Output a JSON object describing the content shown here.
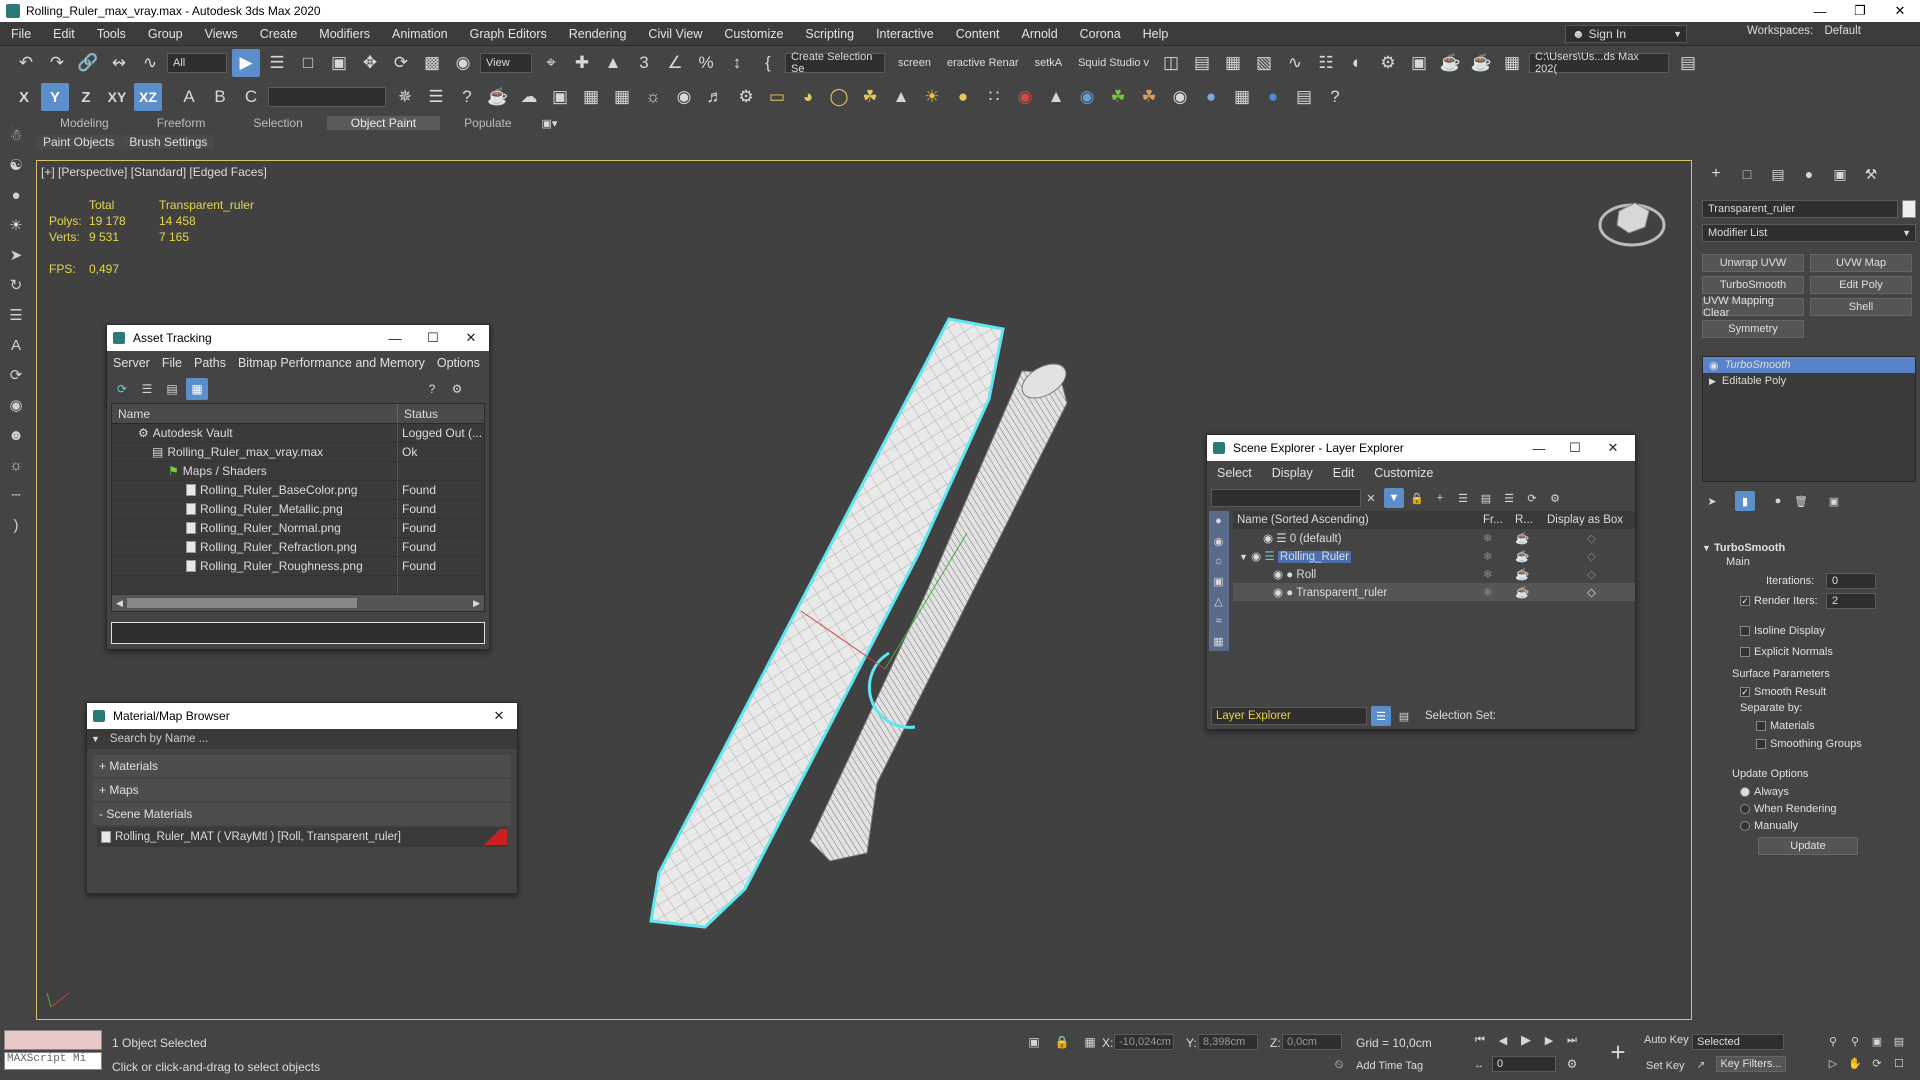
{
  "window": {
    "title": "Rolling_Ruler_max_vray.max - Autodesk 3ds Max 2020"
  },
  "menu": [
    "File",
    "Edit",
    "Tools",
    "Group",
    "Views",
    "Create",
    "Modifiers",
    "Animation",
    "Graph Editors",
    "Rendering",
    "Civil View",
    "Customize",
    "Scripting",
    "Interactive",
    "Content",
    "Arnold",
    "Corona",
    "Help"
  ],
  "signin": {
    "label": "Sign In"
  },
  "workspaces": {
    "label": "Workspaces:",
    "value": "Default"
  },
  "toolbar1": {
    "filter": "All",
    "view": "View",
    "selection_set": "Create Selection Se",
    "screen": "screen",
    "interactive": "eractive Renar",
    "setka": "setkA",
    "squid": "Squid Studio v",
    "path": "C:\\Users\\Us...ds Max 202("
  },
  "toolbar2": {
    "axis_x": "X",
    "axis_y": "Y",
    "axis_z": "Z",
    "axis_xy": "XY",
    "axis_xz": "XZ"
  },
  "ribbon": {
    "tabs": [
      "Modeling",
      "Freeform",
      "Selection",
      "Object Paint",
      "Populate"
    ],
    "active": "Object Paint",
    "sub": [
      "Paint Objects",
      "Brush Settings"
    ]
  },
  "viewport": {
    "label": "[+] [Perspective] [Standard] [Edged Faces]",
    "stats": {
      "header_total": "Total",
      "header_obj": "Transparent_ruler",
      "polys_label": "Polys:",
      "polys_total": "19 178",
      "polys_obj": "14 458",
      "verts_label": "Verts:",
      "verts_total": "9 531",
      "verts_obj": "7 165",
      "fps_label": "FPS:",
      "fps_value": "0,497"
    }
  },
  "asset_tracking": {
    "title": "Asset Tracking",
    "menu": [
      "Server",
      "File",
      "Paths",
      "Bitmap Performance and Memory",
      "Options"
    ],
    "columns": [
      "Name",
      "Status"
    ],
    "rows": [
      {
        "name": "Autodesk Vault",
        "status": "Logged Out (..."
      },
      {
        "name": "Rolling_Ruler_max_vray.max",
        "status": "Ok"
      },
      {
        "name": "Maps / Shaders",
        "status": ""
      },
      {
        "name": "Rolling_Ruler_BaseColor.png",
        "status": "Found"
      },
      {
        "name": "Rolling_Ruler_Metallic.png",
        "status": "Found"
      },
      {
        "name": "Rolling_Ruler_Normal.png",
        "status": "Found"
      },
      {
        "name": "Rolling_Ruler_Refraction.png",
        "status": "Found"
      },
      {
        "name": "Rolling_Ruler_Roughness.png",
        "status": "Found"
      }
    ]
  },
  "material_browser": {
    "title": "Material/Map Browser",
    "search_placeholder": "Search by Name ...",
    "sections": [
      "+ Materials",
      "+ Maps",
      "- Scene Materials"
    ],
    "scene_material": "Rolling_Ruler_MAT ( VRayMtl ) [Roll, Transparent_ruler]"
  },
  "scene_explorer": {
    "title": "Scene Explorer - Layer Explorer",
    "menu": [
      "Select",
      "Display",
      "Edit",
      "Customize"
    ],
    "columns": [
      "Name (Sorted Ascending)",
      "Fr...",
      "R...",
      "Display as Box"
    ],
    "rows": [
      "0 (default)",
      "Rolling_Ruler",
      "Roll",
      "Transparent_ruler"
    ],
    "footer_dropdown": "Layer Explorer",
    "selection_set": "Selection Set:"
  },
  "command_panel": {
    "object_name": "Transparent_ruler",
    "modifier_list": "Modifier List",
    "buttons": [
      "Unwrap UVW",
      "UVW Map",
      "TurboSmooth",
      "Edit Poly",
      "UVW Mapping Clear",
      "Shell",
      "Symmetry"
    ],
    "stack": [
      "TurboSmooth",
      "Editable Poly"
    ],
    "rollout": {
      "title": "TurboSmooth",
      "main": "Main",
      "iterations_label": "Iterations:",
      "iterations": "0",
      "render_iters_label": "Render Iters:",
      "render_iters": "2",
      "isoline": "Isoline Display",
      "explicit": "Explicit Normals",
      "surface": "Surface Parameters",
      "smooth_result": "Smooth Result",
      "separate_by": "Separate by:",
      "materials": "Materials",
      "smoothing_groups": "Smoothing Groups",
      "update_options": "Update Options",
      "always": "Always",
      "when_rendering": "When Rendering",
      "manually": "Manually",
      "update_btn": "Update"
    }
  },
  "status": {
    "maxscript": "MAXScript Mi",
    "selected": "1 Object Selected",
    "hint": "Click or click-and-drag to select objects",
    "x_label": "X:",
    "x": "-10,024cm",
    "y_label": "Y:",
    "y": "8,398cm",
    "z_label": "Z:",
    "z": "0,0cm",
    "grid": "Grid = 10,0cm",
    "add_time_tag": "Add Time Tag",
    "auto_key": "Auto Key",
    "set_key": "Set Key",
    "selected_dropdown": "Selected",
    "key_filters": "Key Filters...",
    "frame": "0"
  }
}
